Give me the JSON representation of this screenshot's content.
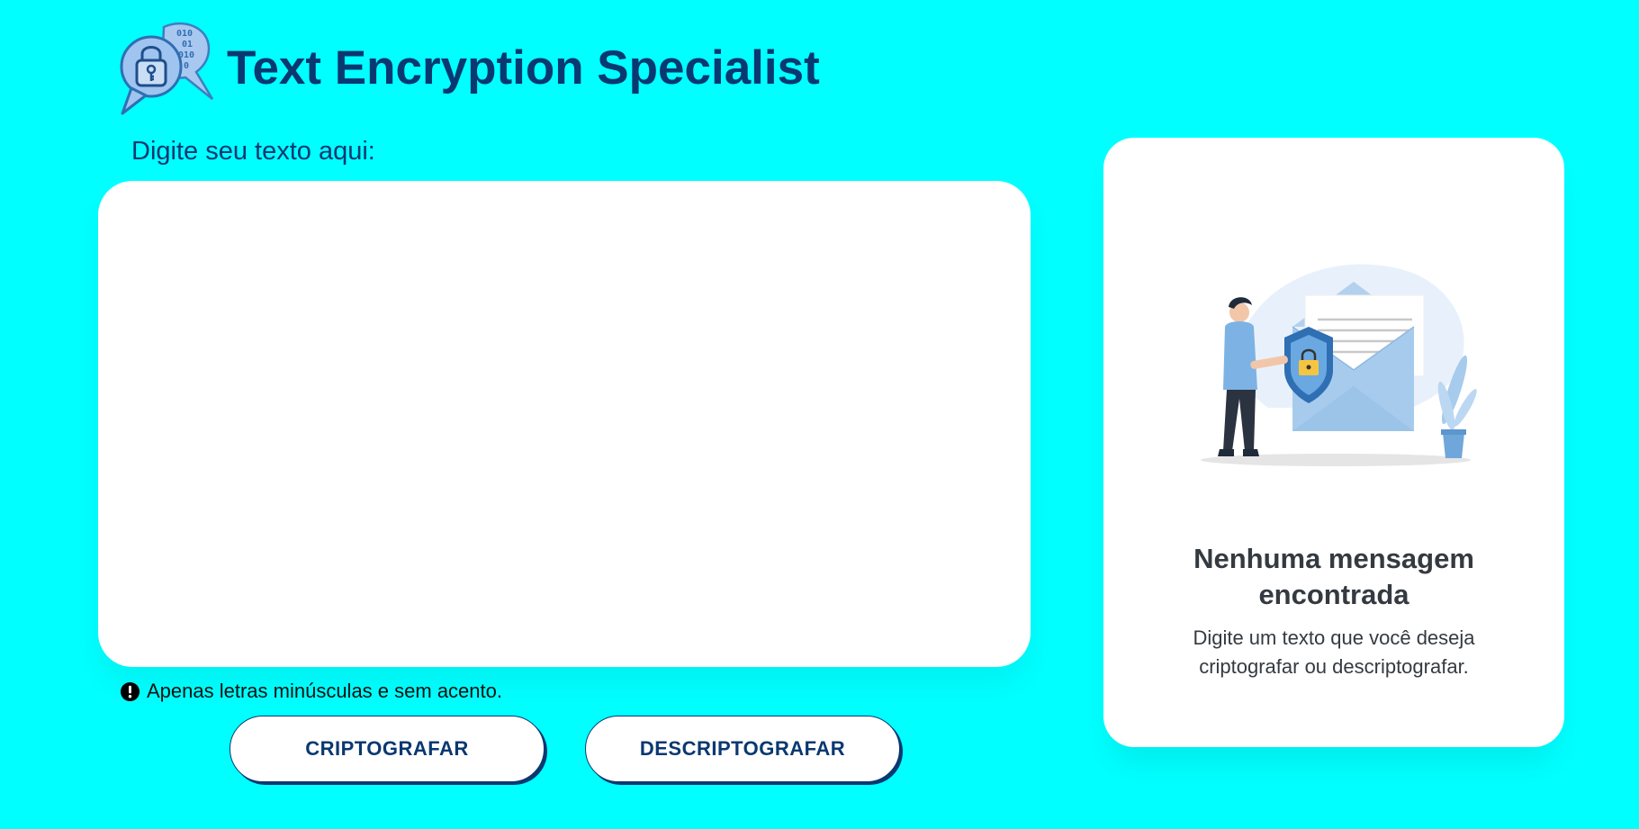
{
  "header": {
    "title": "Text Encryption Specialist",
    "logo_icon": "chat-lock-binary-icon"
  },
  "input": {
    "label": "Digite seu texto aqui:",
    "value": "",
    "placeholder": ""
  },
  "hint": {
    "icon": "exclamation-circle-icon",
    "text": "Apenas letras minúsculas e sem acento."
  },
  "actions": {
    "encrypt_label": "CRIPTOGRAFAR",
    "decrypt_label": "DESCRIPTOGRAFAR"
  },
  "output": {
    "illustration": "man-shield-envelope-illustration",
    "empty_title": "Nenhuma mensagem encontrada",
    "empty_description": "Digite um texto que você deseja criptografar ou descriptografar."
  },
  "colors": {
    "background": "#00ffff",
    "primary": "#0a3871",
    "card": "#ffffff",
    "text_dark": "#343a40"
  }
}
